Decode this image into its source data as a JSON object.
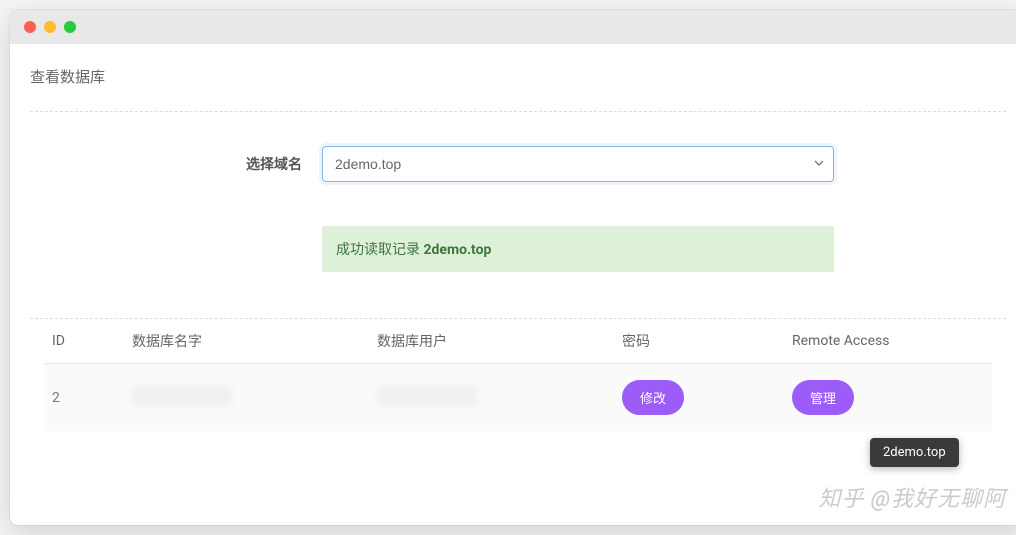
{
  "window": {
    "controls": [
      "close",
      "minimize",
      "maximize"
    ]
  },
  "page": {
    "title": "查看数据库"
  },
  "form": {
    "domain_label": "选择域名",
    "domain_selected": "2demo.top"
  },
  "alert": {
    "prefix": "成功读取记录 ",
    "domain": "2demo.top"
  },
  "table": {
    "headers": {
      "id": "ID",
      "name": "数据库名字",
      "user": "数据库用户",
      "password": "密码",
      "remote": "Remote Access"
    },
    "rows": [
      {
        "id": "2",
        "name": "",
        "user": "",
        "password_action": "修改",
        "remote_action": "管理"
      }
    ]
  },
  "tooltip": {
    "text": "2demo.top"
  },
  "watermark": {
    "text": "知乎 @我好无聊阿"
  }
}
